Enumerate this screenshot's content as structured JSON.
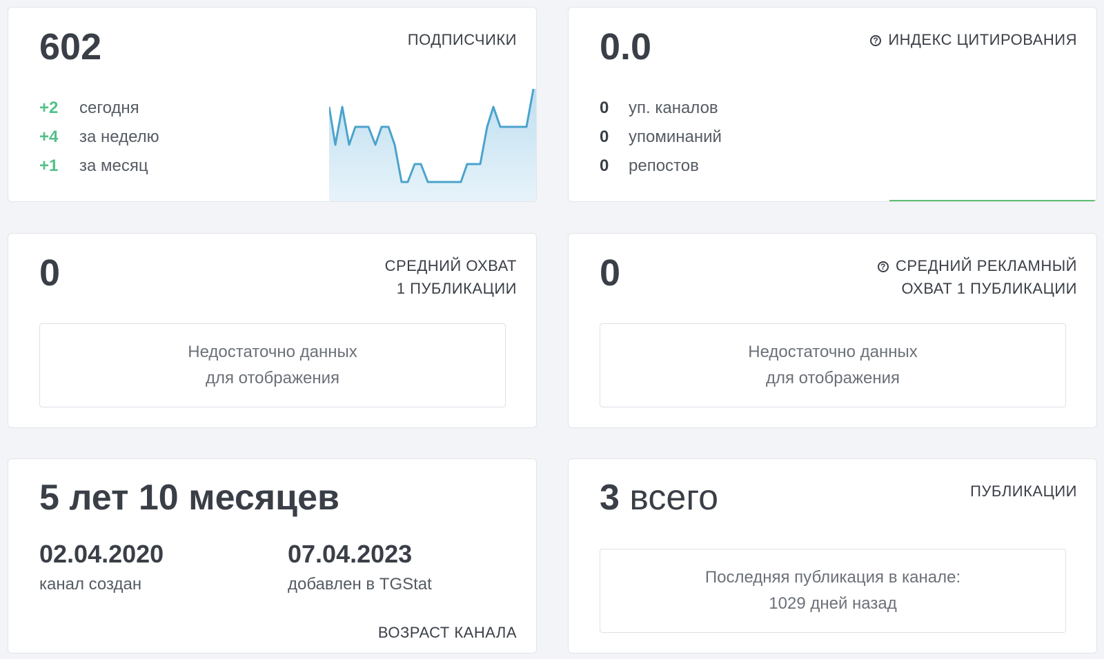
{
  "subscribers": {
    "value": "602",
    "label": "ПОДПИСЧИКИ",
    "stats": [
      {
        "delta": "+2",
        "text": "сегодня"
      },
      {
        "delta": "+4",
        "text": "за неделю"
      },
      {
        "delta": "+1",
        "text": "за месяц"
      }
    ],
    "sparkline_color": "#4aa3cc"
  },
  "citation": {
    "value": "0.0",
    "label": "ИНДЕКС ЦИТИРОВАНИЯ",
    "icon": "help-circle-icon",
    "stats": [
      {
        "count": "0",
        "text": "уп. каналов"
      },
      {
        "count": "0",
        "text": "упоминаний"
      },
      {
        "count": "0",
        "text": "репостов"
      }
    ]
  },
  "avg_reach": {
    "value": "0",
    "label_line1": "СРЕДНИЙ ОХВАТ",
    "label_line2": "1 ПУБЛИКАЦИИ",
    "nodata_line1": "Недостаточно данных",
    "nodata_line2": "для отображения"
  },
  "avg_ad_reach": {
    "value": "0",
    "icon": "help-circle-icon",
    "label_line1": "СРЕДНИЙ РЕКЛАМНЫЙ",
    "label_line2": "ОХВАТ 1 ПУБЛИКАЦИИ",
    "nodata_line1": "Недостаточно данных",
    "nodata_line2": "для отображения"
  },
  "channel_age": {
    "value": "5 лет 10 месяцев",
    "created_date": "02.04.2020",
    "created_label": "канал создан",
    "added_date": "07.04.2023",
    "added_label": "добавлен в TGStat",
    "label": "ВОЗРАСТ КАНАЛА"
  },
  "publications": {
    "count": "3",
    "count_suffix": "всего",
    "label": "ПУБЛИКАЦИИ",
    "last_line1": "Последняя публикация в канале:",
    "last_line2": "1029 дней назад"
  },
  "colors": {
    "positive": "#52c08a",
    "accent_line": "#5cc26f"
  }
}
